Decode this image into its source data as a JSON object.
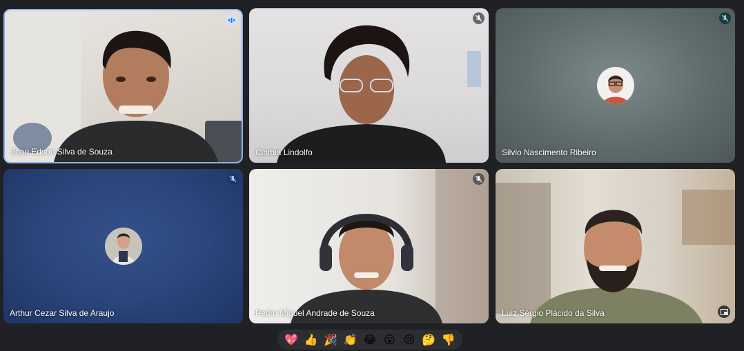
{
  "participants": [
    {
      "name": "Joao Edson Silva de Souza",
      "state": "speaking"
    },
    {
      "name": "Cinthia Lindolfo",
      "state": "muted"
    },
    {
      "name": "Silvio Nascimento Ribeiro",
      "state": "muted",
      "camera": "off"
    },
    {
      "name": "Arthur Cezar Silva de Araujo",
      "state": "muted",
      "camera": "off"
    },
    {
      "name": "Pedro Miguel Andrade de Souza",
      "state": "muted"
    },
    {
      "name": "Luiz Sérgio Plácido da Silva",
      "state": "unmuted"
    }
  ],
  "reactions": [
    "💖",
    "👍",
    "🎉",
    "👏",
    "😂",
    "😮",
    "😢",
    "🤔",
    "👎"
  ],
  "colors": {
    "background": "#202124",
    "active_speaker_border": "#8ab4f8",
    "reaction_bar": "#2d2e31"
  }
}
